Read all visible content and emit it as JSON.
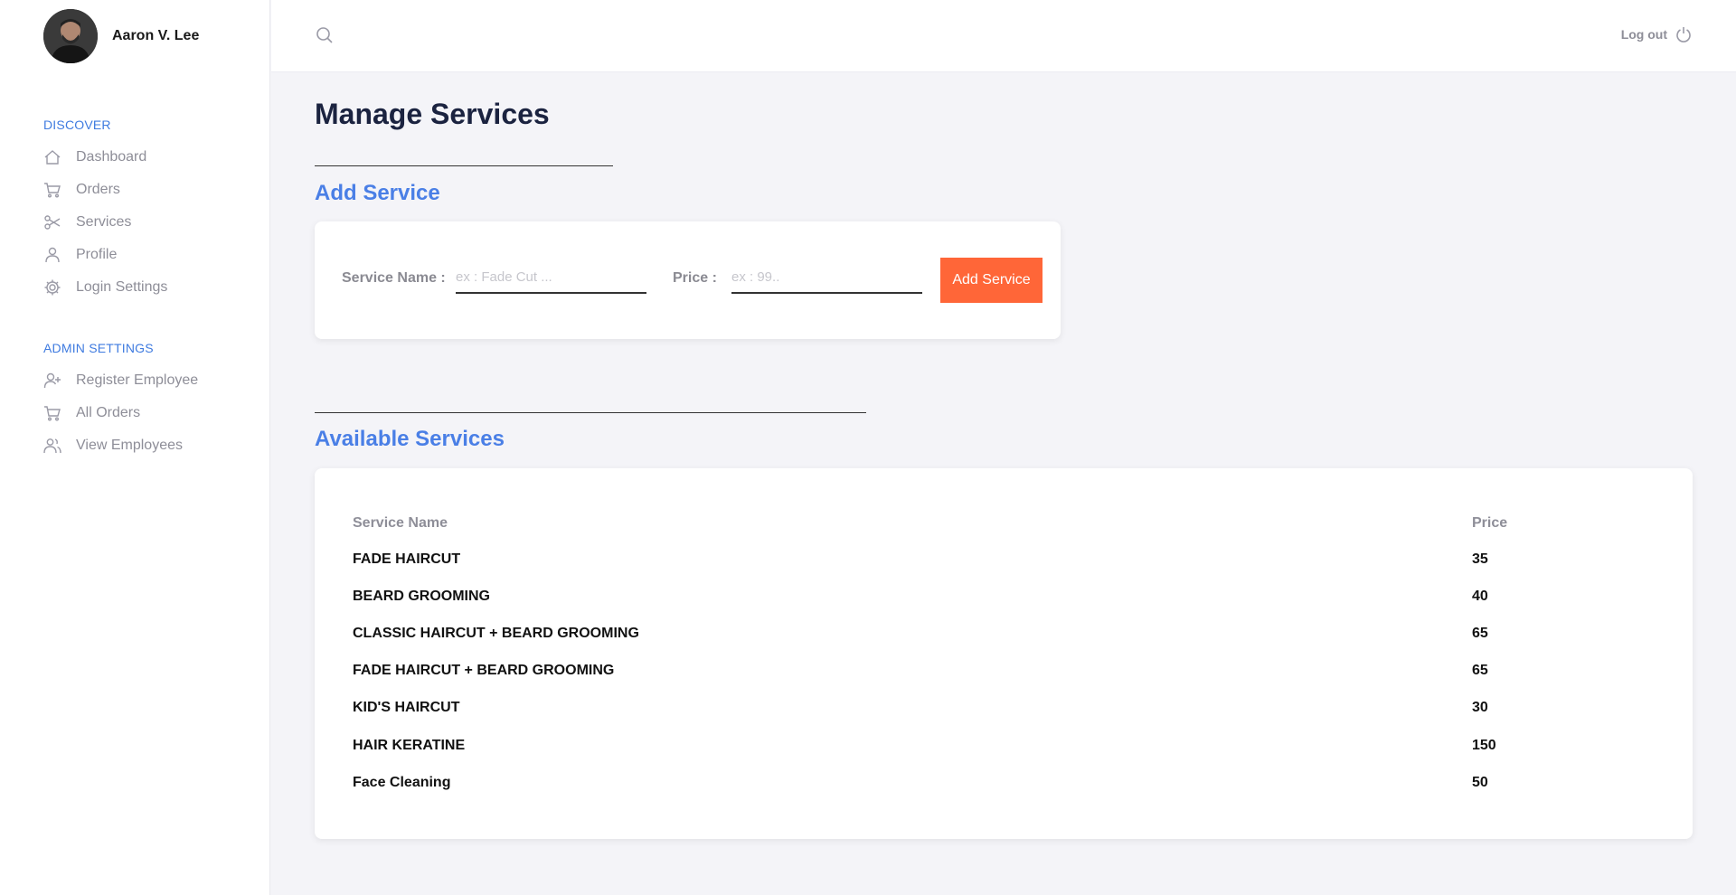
{
  "user": {
    "name": "Aaron V. Lee",
    "avatar_icon": "user-avatar"
  },
  "sidebar": {
    "discover_label": "DISCOVER",
    "discover_items": [
      {
        "label": "Dashboard",
        "icon": "home-icon"
      },
      {
        "label": "Orders",
        "icon": "cart-icon"
      },
      {
        "label": "Services",
        "icon": "scissors-icon"
      },
      {
        "label": "Profile",
        "icon": "user-icon"
      },
      {
        "label": "Login Settings",
        "icon": "gear-icon"
      }
    ],
    "admin_label": "ADMIN SETTINGS",
    "admin_items": [
      {
        "label": "Register Employee",
        "icon": "user-plus-icon"
      },
      {
        "label": "All Orders",
        "icon": "cart-icon"
      },
      {
        "label": "View Employees",
        "icon": "users-icon"
      }
    ]
  },
  "topbar": {
    "logout_label": "Log out"
  },
  "page": {
    "title": "Manage Services",
    "add_section_title": "Add Service",
    "service_name_label": "Service Name :",
    "service_name_placeholder": "ex : Fade Cut ...",
    "service_name_value": "",
    "price_label": "Price :",
    "price_placeholder": "ex : 99..",
    "price_value": "",
    "add_button_label": "Add Service",
    "available_section_title": "Available Services"
  },
  "table": {
    "headers": {
      "name": "Service Name",
      "price": "Price"
    },
    "rows": [
      {
        "name": "FADE HAIRCUT",
        "price": "35"
      },
      {
        "name": "BEARD GROOMING",
        "price": "40"
      },
      {
        "name": "CLASSIC HAIRCUT + BEARD GROOMING",
        "price": "65"
      },
      {
        "name": "FADE HAIRCUT + BEARD GROOMING",
        "price": "65"
      },
      {
        "name": "KID'S HAIRCUT",
        "price": "30"
      },
      {
        "name": "HAIR KERATINE",
        "price": "150"
      },
      {
        "name": "Face Cleaning",
        "price": "50"
      }
    ]
  },
  "colors": {
    "accent_blue": "#4a7fe6",
    "button_orange": "#ff6638",
    "title_navy": "#1b2340"
  }
}
